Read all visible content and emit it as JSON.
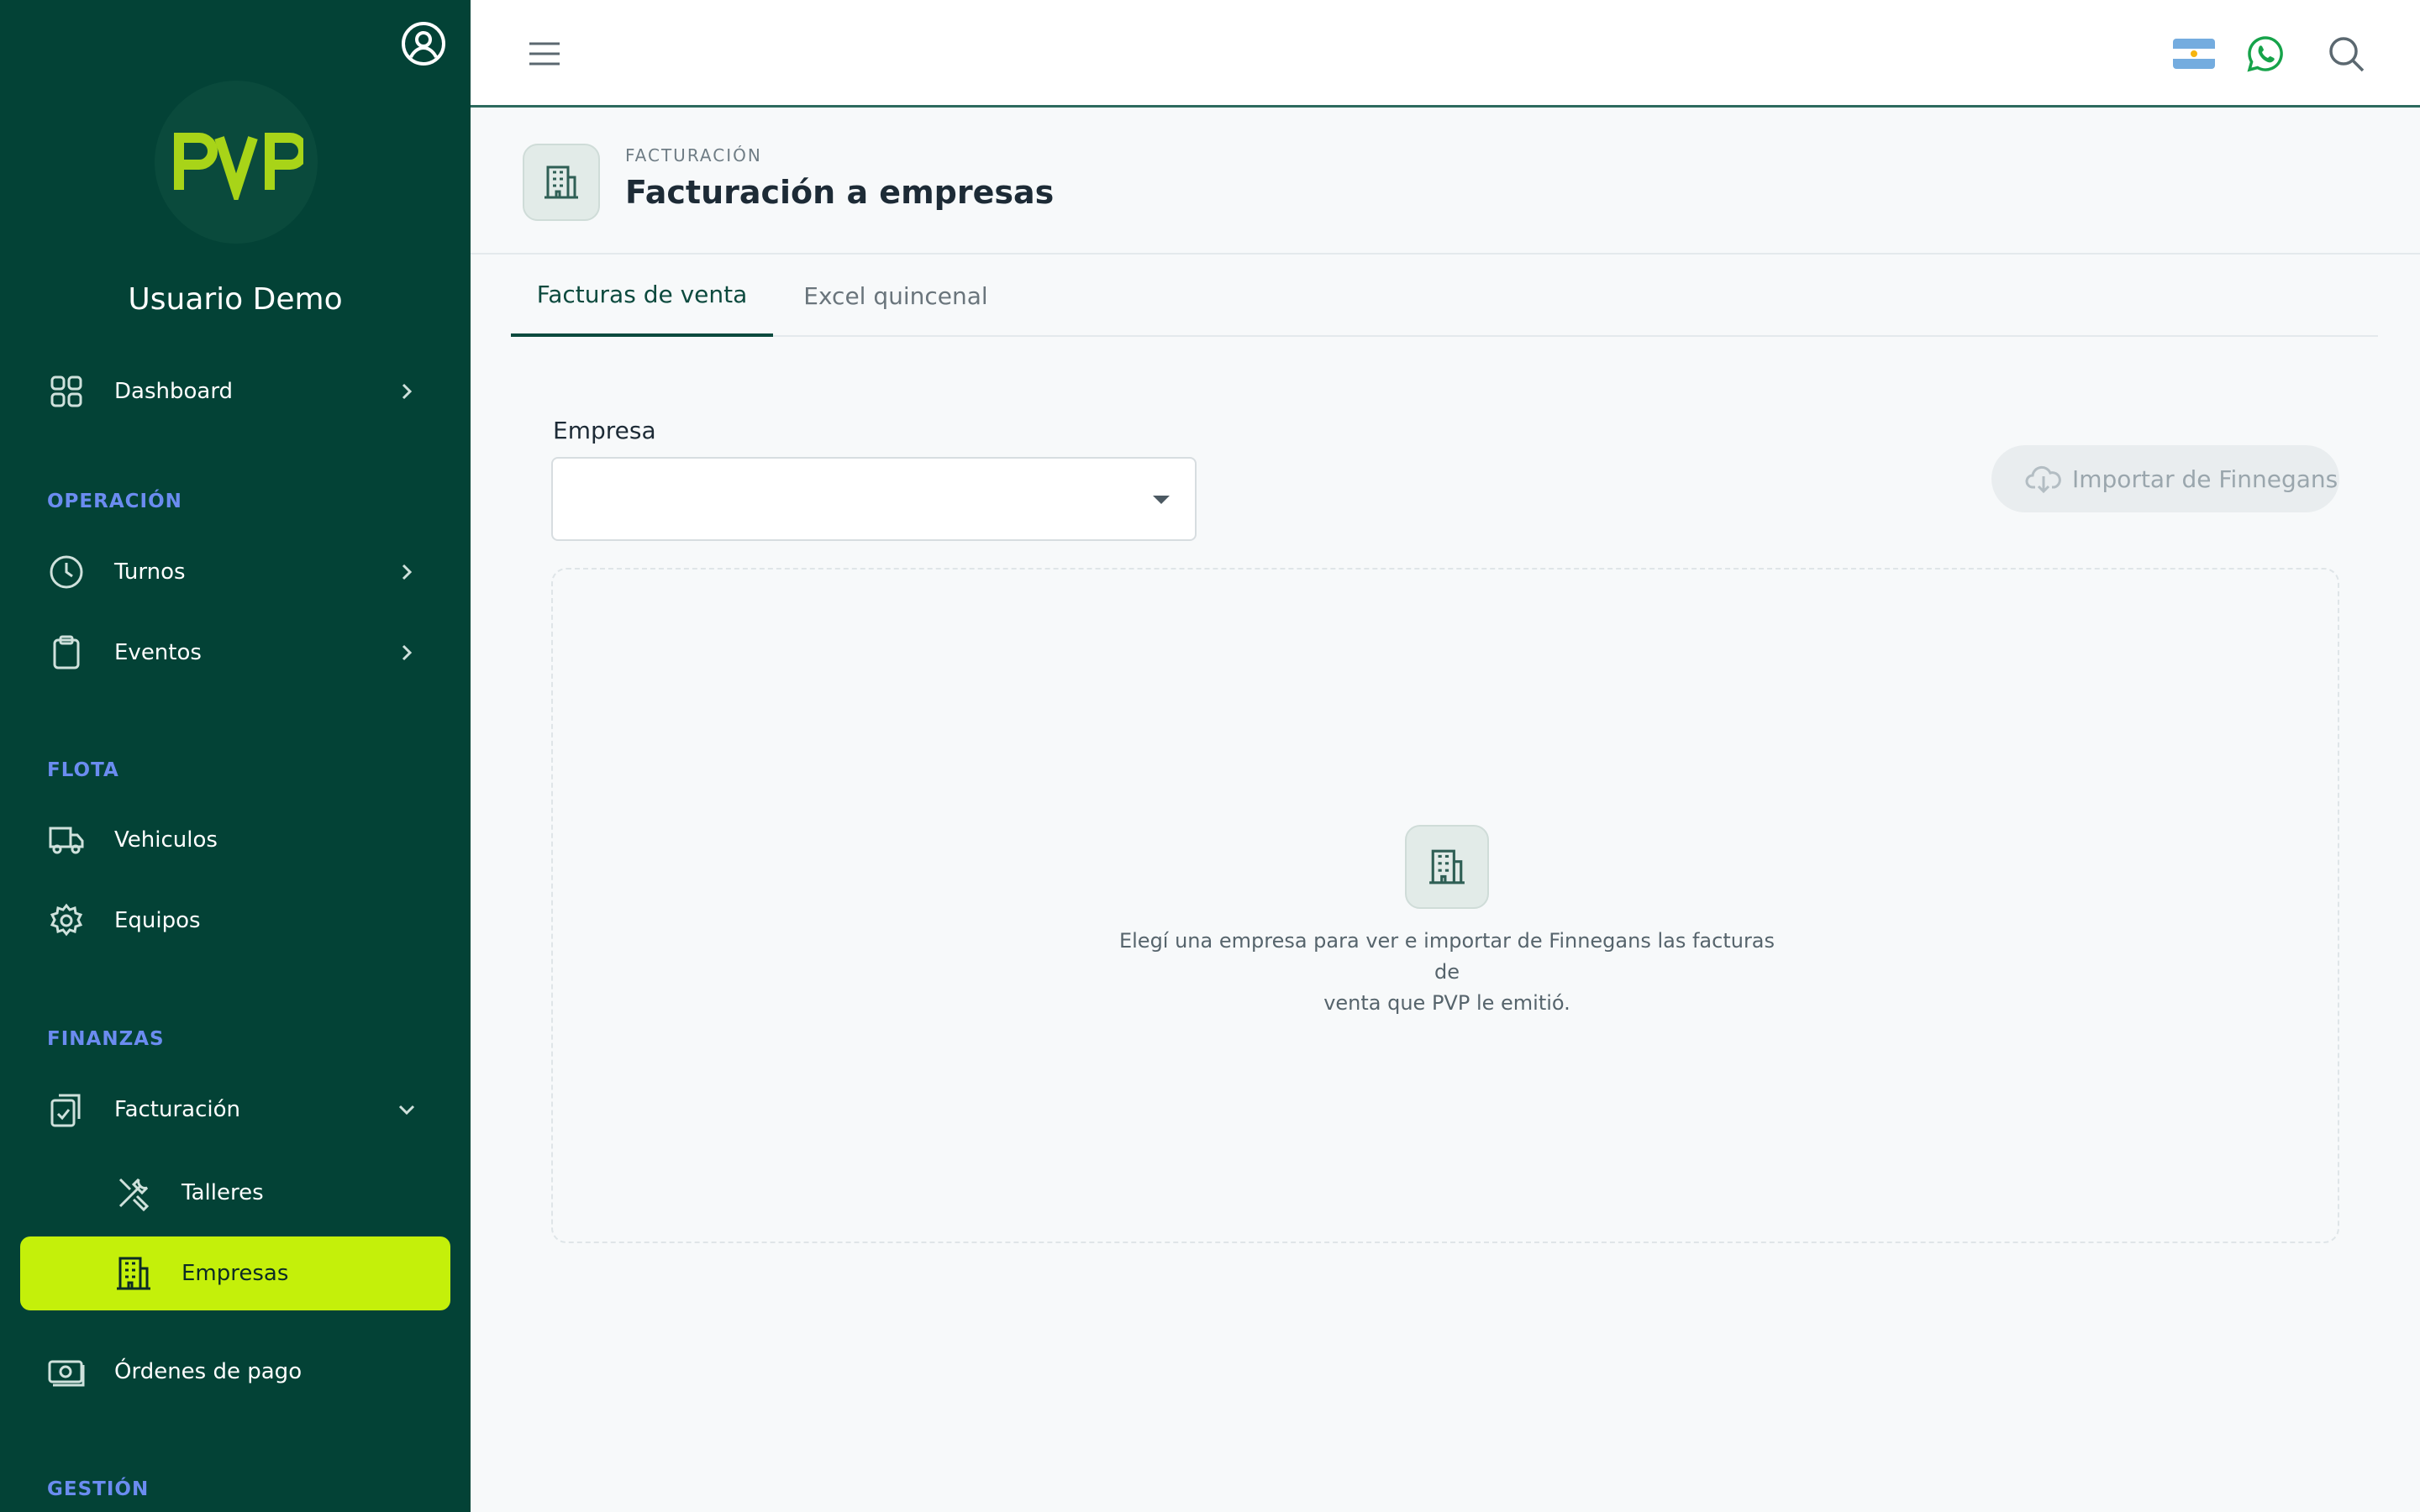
{
  "sidebar": {
    "user_name": "Usuario Demo",
    "logo_text": "PVP",
    "sections": {
      "operacion": "OPERACIÓN",
      "flota": "FLOTA",
      "finanzas": "FINANZAS",
      "gestion": "GESTIÓN"
    },
    "items": {
      "dashboard": "Dashboard",
      "turnos": "Turnos",
      "eventos": "Eventos",
      "vehiculos": "Vehiculos",
      "equipos": "Equipos",
      "facturacion": "Facturación",
      "talleres": "Talleres",
      "empresas": "Empresas",
      "ordenes": "Órdenes de pago"
    },
    "active_item": "Empresas"
  },
  "header": {
    "breadcrumb": "FACTURACIÓN",
    "title": "Facturación a empresas"
  },
  "tabs": [
    {
      "label": "Facturas de venta",
      "active": true
    },
    {
      "label": "Excel quincenal",
      "active": false
    }
  ],
  "form": {
    "empresa_label": "Empresa",
    "empresa_value": "",
    "import_button": "Importar de Finnegans"
  },
  "empty_state": {
    "line1": "Elegí una empresa para ver e importar de Finnegans las facturas de",
    "line2": "venta que PVP le emitió."
  },
  "colors": {
    "sidebar_bg": "#034236",
    "accent": "#c4f00a",
    "section_label": "#6b8cf0",
    "whatsapp": "#16a34a"
  },
  "icons": [
    "account-icon",
    "menu-icon",
    "argentina-flag-icon",
    "whatsapp-icon",
    "search-icon",
    "building-icon",
    "cloud-download-icon"
  ]
}
